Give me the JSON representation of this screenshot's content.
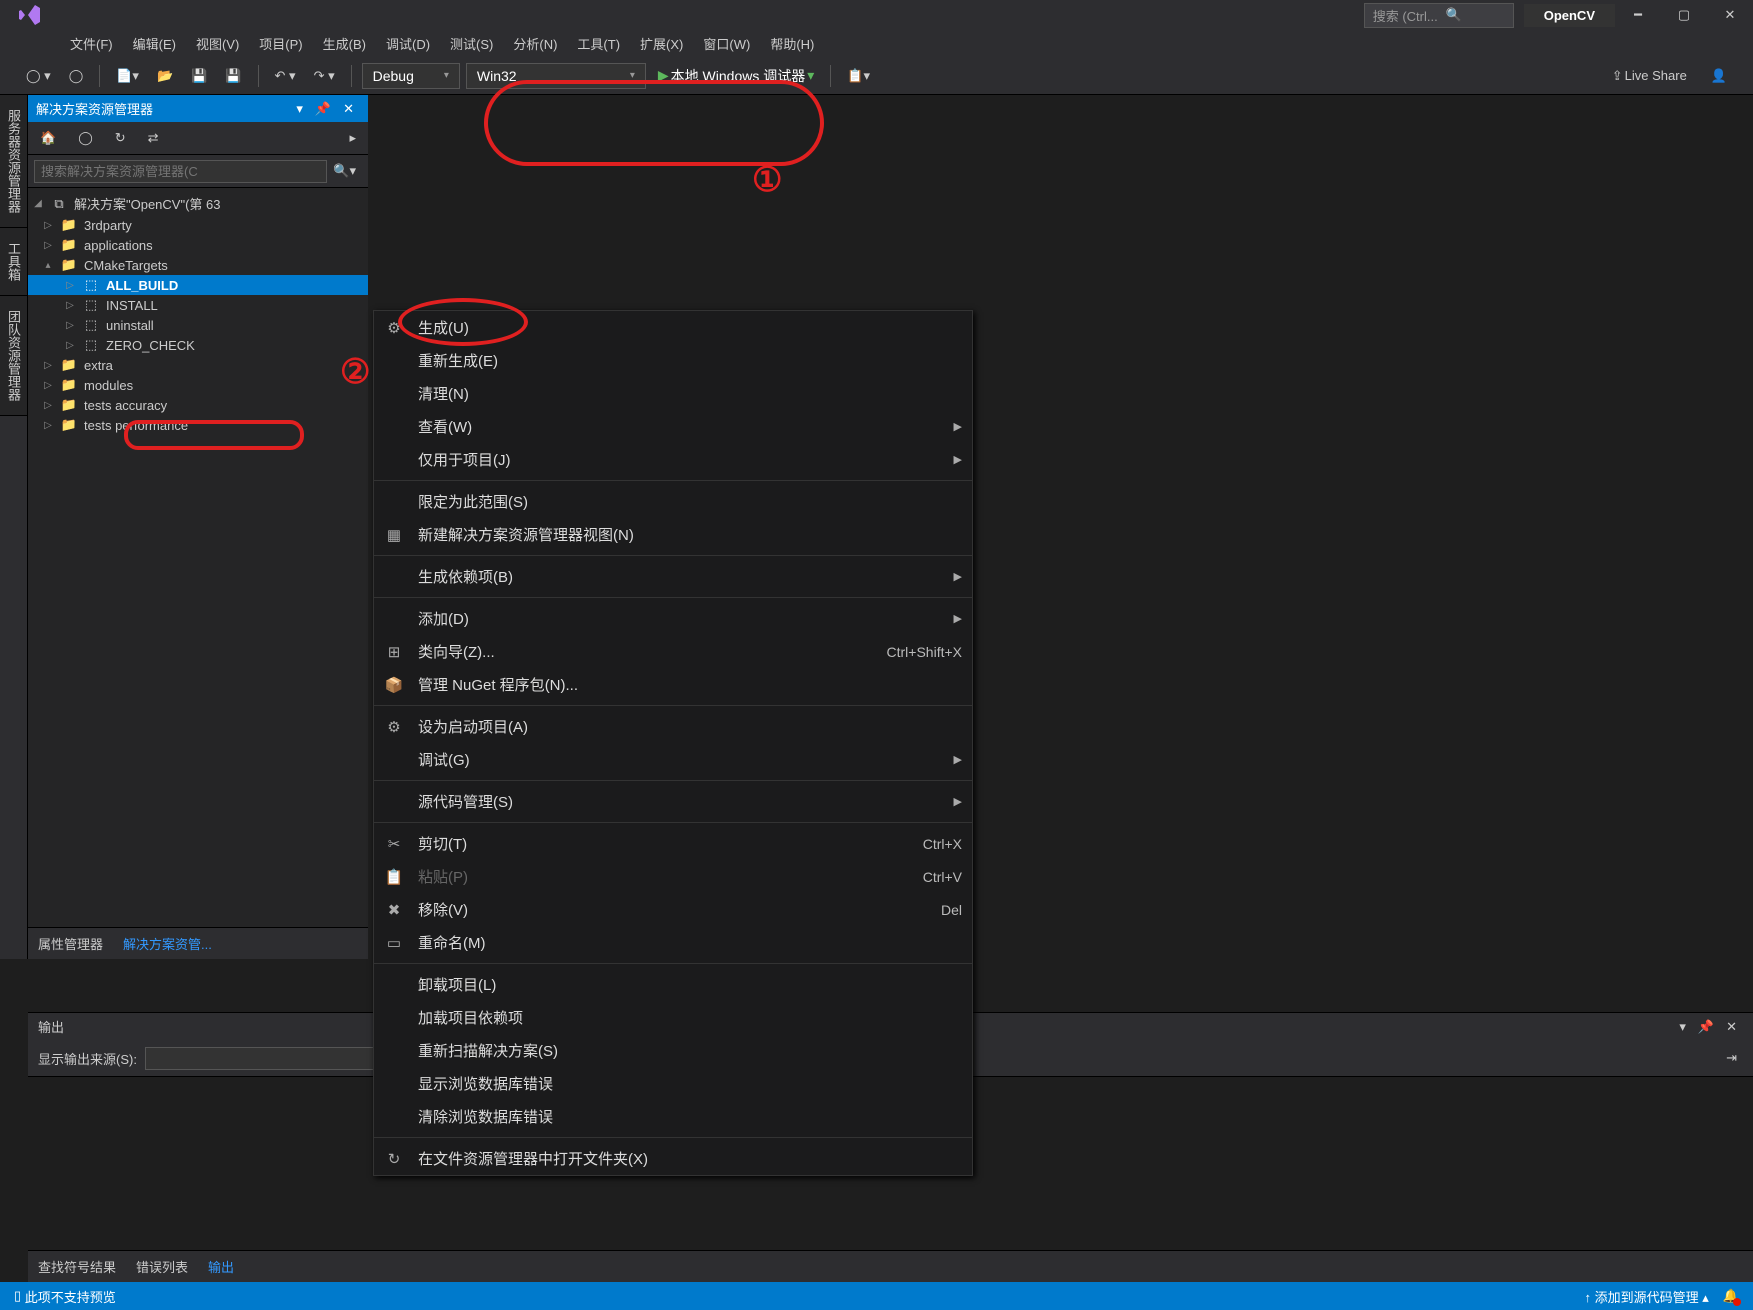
{
  "titlebar": {
    "search_placeholder": "搜索 (Ctrl...",
    "app_name": "OpenCV"
  },
  "menubar": {
    "items": [
      "文件(F)",
      "编辑(E)",
      "视图(V)",
      "项目(P)",
      "生成(B)",
      "调试(D)",
      "测试(S)",
      "分析(N)",
      "工具(T)",
      "扩展(X)",
      "窗口(W)",
      "帮助(H)"
    ]
  },
  "toolbar": {
    "config": "Debug",
    "platform": "Win32",
    "debugger": "本地 Windows 调试器",
    "live_share": "Live Share"
  },
  "sidebar_tabs": [
    "服务器资源管理器",
    "工具箱",
    "团队资源管理器"
  ],
  "explorer": {
    "title": "解决方案资源管理器",
    "search_placeholder": "搜索解决方案资源管理器(C",
    "solution": "解决方案\"OpenCV\"(第 63 ",
    "tree": [
      {
        "depth": 0,
        "caret": "▷",
        "icon": "folder",
        "label": "3rdparty"
      },
      {
        "depth": 0,
        "caret": "▷",
        "icon": "folder",
        "label": "applications"
      },
      {
        "depth": 0,
        "caret": "▴",
        "icon": "folder",
        "label": "CMakeTargets"
      },
      {
        "depth": 1,
        "caret": "▷",
        "icon": "project",
        "label": "ALL_BUILD",
        "selected": true,
        "bold": true
      },
      {
        "depth": 1,
        "caret": "▷",
        "icon": "project",
        "label": "INSTALL"
      },
      {
        "depth": 1,
        "caret": "▷",
        "icon": "project",
        "label": "uninstall"
      },
      {
        "depth": 1,
        "caret": "▷",
        "icon": "project",
        "label": "ZERO_CHECK"
      },
      {
        "depth": 0,
        "caret": "▷",
        "icon": "folder",
        "label": "extra"
      },
      {
        "depth": 0,
        "caret": "▷",
        "icon": "folder",
        "label": "modules"
      },
      {
        "depth": 0,
        "caret": "▷",
        "icon": "folder",
        "label": "tests accuracy"
      },
      {
        "depth": 0,
        "caret": "▷",
        "icon": "folder",
        "label": "tests performance"
      }
    ],
    "bottom_tabs": [
      {
        "label": "属性管理器",
        "active": false
      },
      {
        "label": "解决方案资管...",
        "active": true
      }
    ]
  },
  "context_menu": [
    {
      "icon": "build",
      "label": "生成(U)",
      "highlight": true
    },
    {
      "label": "重新生成(E)"
    },
    {
      "label": "清理(N)"
    },
    {
      "label": "查看(W)",
      "arrow": true
    },
    {
      "label": "仅用于项目(J)",
      "arrow": true
    },
    {
      "sep": true
    },
    {
      "label": "限定为此范围(S)"
    },
    {
      "icon": "newview",
      "label": "新建解决方案资源管理器视图(N)"
    },
    {
      "sep": true
    },
    {
      "label": "生成依赖项(B)",
      "arrow": true
    },
    {
      "sep": true
    },
    {
      "label": "添加(D)",
      "arrow": true
    },
    {
      "icon": "class",
      "label": "类向导(Z)...",
      "shortcut": "Ctrl+Shift+X"
    },
    {
      "icon": "nuget",
      "label": "管理 NuGet 程序包(N)..."
    },
    {
      "sep": true
    },
    {
      "icon": "gear",
      "label": "设为启动项目(A)"
    },
    {
      "label": "调试(G)",
      "arrow": true
    },
    {
      "sep": true
    },
    {
      "label": "源代码管理(S)",
      "arrow": true
    },
    {
      "sep": true
    },
    {
      "icon": "cut",
      "label": "剪切(T)",
      "shortcut": "Ctrl+X"
    },
    {
      "icon": "paste",
      "label": "粘贴(P)",
      "shortcut": "Ctrl+V",
      "disabled": true
    },
    {
      "icon": "remove",
      "label": "移除(V)",
      "shortcut": "Del"
    },
    {
      "icon": "rename",
      "label": "重命名(M)"
    },
    {
      "sep": true
    },
    {
      "label": "卸载项目(L)"
    },
    {
      "label": "加载项目依赖项"
    },
    {
      "label": "重新扫描解决方案(S)"
    },
    {
      "label": "显示浏览数据库错误"
    },
    {
      "label": "清除浏览数据库错误"
    },
    {
      "sep": true
    },
    {
      "icon": "open",
      "label": "在文件资源管理器中打开文件夹(X)"
    }
  ],
  "output": {
    "title": "输出",
    "label": "显示输出来源(S):",
    "tabs": [
      {
        "label": "查找符号结果"
      },
      {
        "label": "错误列表"
      },
      {
        "label": "输出",
        "active": true
      }
    ]
  },
  "statusbar": {
    "msg": "此项不支持预览",
    "scm": "添加到源代码管理"
  }
}
